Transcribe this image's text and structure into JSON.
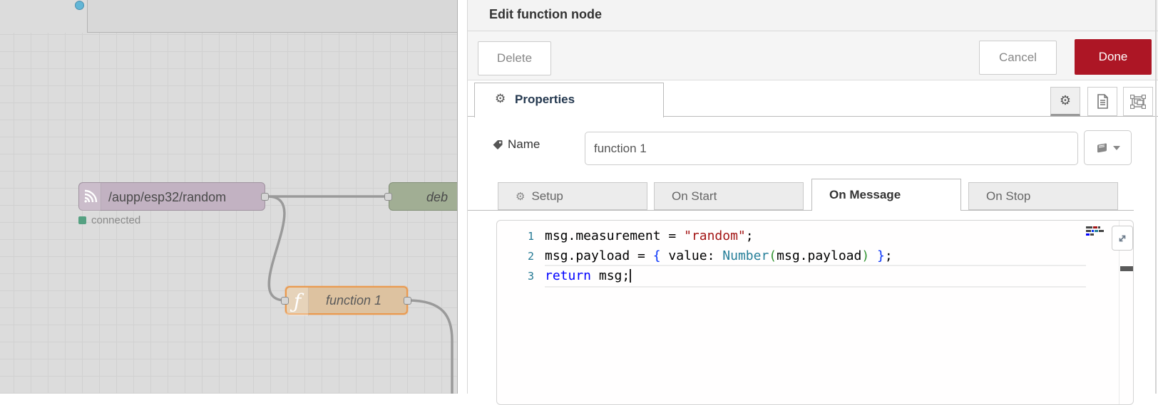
{
  "icons": {
    "gear": "⚙"
  },
  "colors": {
    "accent_red": "#AD1625",
    "node_mqtt": "#c2b2c2",
    "node_debug": "#a1ae94",
    "node_function": "#ddc2a0",
    "node_selected_border": "#ea9a50",
    "status_connected_green": "#55a182",
    "token_string": "#a31515",
    "token_keyword": "#0000ff",
    "token_type": "#267f99",
    "token_brace": "#0431fa",
    "token_paren": "#319331",
    "line_number_teal": "#237893"
  },
  "canvas": {
    "mqtt_node": {
      "label": "/aupp/esp32/random",
      "status": "connected"
    },
    "debug_node": {
      "label": "deb"
    },
    "function_node": {
      "label": "function 1",
      "glyph": "ƒ"
    }
  },
  "dialog": {
    "title": "Edit function node",
    "toolbar": {
      "delete": "Delete",
      "cancel": "Cancel",
      "done": "Done"
    },
    "properties_tab": "Properties",
    "name_field": {
      "label": "Name",
      "value": "function 1"
    },
    "function_tabs": [
      {
        "label": "Setup"
      },
      {
        "label": "On Start"
      },
      {
        "label": "On Message"
      },
      {
        "label": "On Stop"
      }
    ],
    "editor": {
      "line_numbers": [
        "1",
        "2",
        "3"
      ],
      "lines": [
        {
          "tokens": [
            {
              "t": "msg.measurement = ",
              "c": "d"
            },
            {
              "t": "\"random\"",
              "c": "s"
            },
            {
              "t": ";",
              "c": "d"
            }
          ]
        },
        {
          "tokens": [
            {
              "t": "msg.payload = ",
              "c": "d"
            },
            {
              "t": "{",
              "c": "b"
            },
            {
              "t": " value: ",
              "c": "d"
            },
            {
              "t": "Number",
              "c": "y"
            },
            {
              "t": "(",
              "c": "p"
            },
            {
              "t": "msg.payload",
              "c": "d"
            },
            {
              "t": ")",
              "c": "p"
            },
            {
              "t": " ",
              "c": "d"
            },
            {
              "t": "}",
              "c": "b"
            },
            {
              "t": ";",
              "c": "d"
            }
          ]
        },
        {
          "tokens": [
            {
              "t": "return",
              "c": "k"
            },
            {
              "t": " msg;",
              "c": "d"
            }
          ]
        }
      ]
    }
  }
}
